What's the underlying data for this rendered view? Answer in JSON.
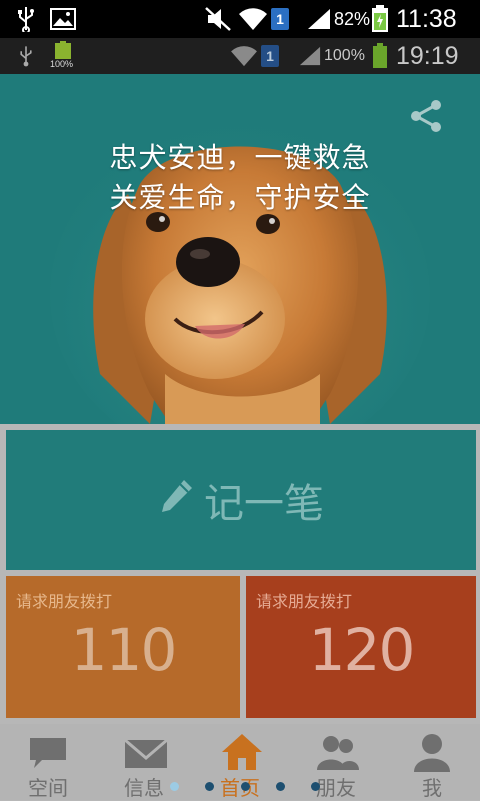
{
  "status_bar_primary": {
    "battery_percent": "82%",
    "time": "11:38",
    "sim": "1"
  },
  "status_bar_secondary": {
    "battery_badge": "100%",
    "battery_percent": "100%",
    "time": "19:19",
    "sim": "1"
  },
  "hero": {
    "line1": "忠犬安迪，一键救急",
    "line2": "关爱生命，守护安全",
    "share_icon": "share-icon"
  },
  "note_tile": {
    "label": "记一笔",
    "icon": "pencil-icon"
  },
  "call_tiles": [
    {
      "caption": "请求朋友拨打",
      "number": "110",
      "color": "#b66a2a"
    },
    {
      "caption": "请求朋友拨打",
      "number": "120",
      "color": "#a73f1d"
    }
  ],
  "nav": {
    "items": [
      {
        "label": "空间",
        "icon": "chat-icon"
      },
      {
        "label": "信息",
        "icon": "mail-icon"
      },
      {
        "label": "首页",
        "icon": "home-icon",
        "active": true
      },
      {
        "label": "朋友",
        "icon": "friends-icon"
      },
      {
        "label": "我",
        "icon": "person-icon"
      }
    ],
    "page_count": 5,
    "active_page": 1
  },
  "colors": {
    "hero_bg": "#1f7b7a",
    "accent_orange": "#c8711f",
    "nav_bg": "#b4b4b4"
  }
}
